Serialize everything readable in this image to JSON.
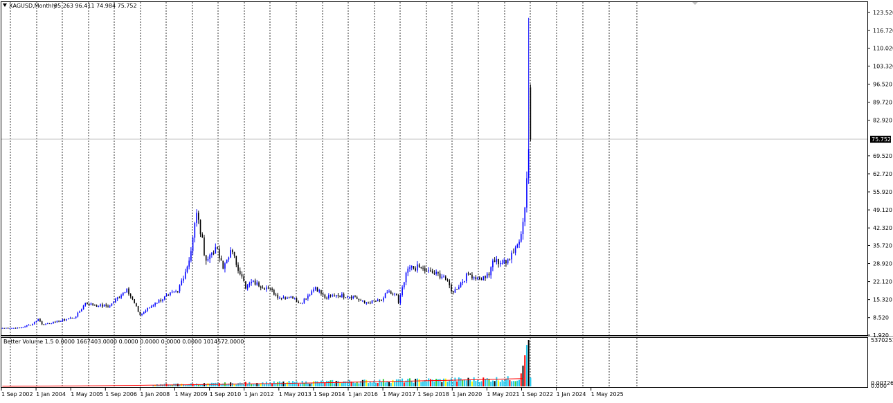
{
  "window": {
    "menu_icon": "triangle-down-icon",
    "symbol_label": "XAGUSD,Monthly",
    "ohlc_label": "95.263 96.411 74.984 75.752",
    "indicator_label": "Better Volume 1.5 0.0000 1667403.0000 0.0000 0.0000 0.0000 0.0000 1014572.0000",
    "current_price_label": "75.752"
  },
  "colors": {
    "background": "#ffffff",
    "up_candle": "#0000ff",
    "down_candle": "#000000",
    "grid": "#000000",
    "price_line": "#c0c0c0",
    "vol_cyan": "#1ec8ee",
    "vol_red": "#ff0000",
    "vol_black": "#000000",
    "vol_green": "#32cd32",
    "vol_yellow": "#ffff00",
    "vol_ma": "#ff0000"
  },
  "chart_data": [
    {
      "type": "candlestick",
      "title": "XAGUSD,Monthly",
      "ylim": [
        1.92,
        123.52
      ],
      "y_ticks": [
        "123.520",
        "116.720",
        "110.020",
        "103.320",
        "96.520",
        "89.720",
        "82.920",
        "75.752",
        "69.520",
        "62.720",
        "55.920",
        "49.120",
        "42.320",
        "35.720",
        "28.920",
        "22.120",
        "15.320",
        "8.520",
        "1.920"
      ],
      "x_ticks": [
        "1 Sep 2002",
        "1 Jan 2004",
        "1 May 2005",
        "1 Sep 2006",
        "1 Jan 2008",
        "1 May 2009",
        "1 Sep 2010",
        "1 Jan 2012",
        "1 May 2013",
        "1 Sep 2014",
        "1 Jan 2016",
        "1 May 2017",
        "1 Sep 2018",
        "1 Jan 2020",
        "1 May 2021",
        "1 Sep 2022",
        "1 Jan 2024",
        "1 May 2025"
      ],
      "last_bar": {
        "open": 95.263,
        "high": 96.411,
        "low": 74.984,
        "close": 75.752
      },
      "anchor_points": [
        [
          "2002-09",
          4.6
        ],
        [
          "2003-06",
          4.6
        ],
        [
          "2004-01",
          6.2
        ],
        [
          "2004-04",
          8.0
        ],
        [
          "2004-06",
          6.0
        ],
        [
          "2005-01",
          6.8
        ],
        [
          "2005-12",
          8.9
        ],
        [
          "2006-05",
          14.0
        ],
        [
          "2006-12",
          13.0
        ],
        [
          "2007-06",
          13.0
        ],
        [
          "2008-03",
          19.5
        ],
        [
          "2008-10",
          9.5
        ],
        [
          "2009-06",
          14.0
        ],
        [
          "2010-01",
          17.0
        ],
        [
          "2010-06",
          18.5
        ],
        [
          "2010-12",
          30.0
        ],
        [
          "2011-04",
          48.0
        ],
        [
          "2011-09",
          30.0
        ],
        [
          "2012-02",
          35.0
        ],
        [
          "2012-06",
          27.0
        ],
        [
          "2012-10",
          34.0
        ],
        [
          "2013-04",
          24.0
        ],
        [
          "2013-06",
          19.5
        ],
        [
          "2013-09",
          22.0
        ],
        [
          "2014-06",
          19.5
        ],
        [
          "2014-12",
          16.0
        ],
        [
          "2015-06",
          16.5
        ],
        [
          "2015-11",
          14.0
        ],
        [
          "2016-07",
          20.0
        ],
        [
          "2016-12",
          16.0
        ],
        [
          "2017-06",
          17.0
        ],
        [
          "2018-03",
          16.5
        ],
        [
          "2018-09",
          14.0
        ],
        [
          "2019-06",
          15.0
        ],
        [
          "2019-09",
          18.0
        ],
        [
          "2020-02",
          17.0
        ],
        [
          "2020-03",
          14.0
        ],
        [
          "2020-08",
          27.0
        ],
        [
          "2021-02",
          27.5
        ],
        [
          "2021-06",
          26.0
        ],
        [
          "2022-03",
          24.0
        ],
        [
          "2022-08",
          18.0
        ],
        [
          "2023-04",
          25.0
        ],
        [
          "2023-10",
          23.0
        ],
        [
          "2024-03",
          24.5
        ],
        [
          "2024-05",
          30.0
        ],
        [
          "2024-12",
          29.0
        ],
        [
          "2025-03",
          33.0
        ],
        [
          "2025-06",
          36.0
        ],
        [
          "2025-08",
          40.0
        ],
        [
          "2025-10",
          50.0
        ],
        [
          "2025-12",
          72.0
        ],
        [
          "2026-01",
          95.263
        ]
      ],
      "spike": {
        "month": "2026-01",
        "high": 121.5
      }
    },
    {
      "type": "bar",
      "title": "Better Volume 1.5",
      "y_ticks": [
        "5370251.",
        "0.00726.",
        "0.000"
      ],
      "ylim": [
        0,
        5370251
      ],
      "color_cycle": [
        "cyan",
        "cyan",
        "cyan",
        "red",
        "cyan",
        "cyan",
        "green",
        "cyan",
        "cyan",
        "black",
        "cyan",
        "yellow",
        "cyan",
        "cyan"
      ],
      "tail_bars": [
        {
          "month": "2025-08",
          "value": 1500000,
          "color": "red"
        },
        {
          "month": "2025-09",
          "value": 2400000,
          "color": "black"
        },
        {
          "month": "2025-10",
          "value": 3600000,
          "color": "red"
        },
        {
          "month": "2025-11",
          "value": 4800000,
          "color": "cyan"
        },
        {
          "month": "2025-12",
          "value": 5370251,
          "color": "black"
        },
        {
          "month": "2026-01",
          "value": 1014572,
          "color": "cyan"
        }
      ]
    }
  ]
}
